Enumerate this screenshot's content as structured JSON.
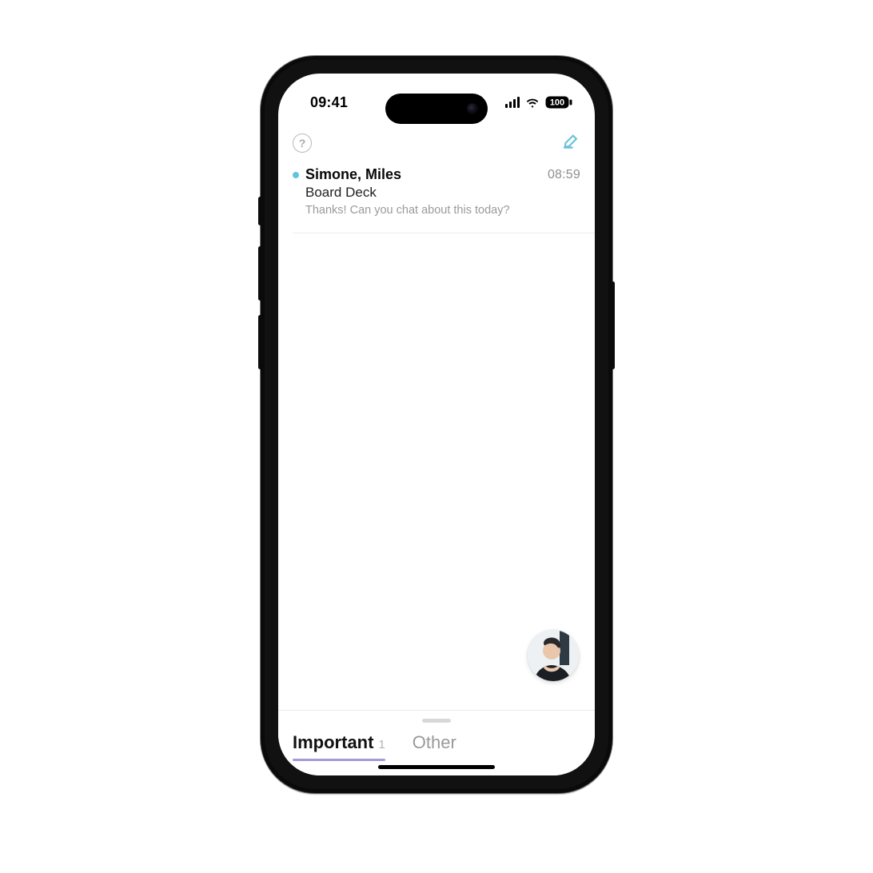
{
  "status": {
    "time": "09:41",
    "battery": "100"
  },
  "header": {
    "help_label": "?",
    "compose_label": "Compose"
  },
  "messages": [
    {
      "unread": true,
      "sender": "Simone, Miles",
      "time": "08:59",
      "subject": "Board Deck",
      "preview": "Thanks! Can you chat about this today?"
    }
  ],
  "tabs": {
    "items": [
      {
        "label": "Important",
        "count": "1",
        "active": true
      },
      {
        "label": "Other",
        "active": false
      }
    ]
  },
  "avatar": {
    "name": "user-avatar"
  }
}
